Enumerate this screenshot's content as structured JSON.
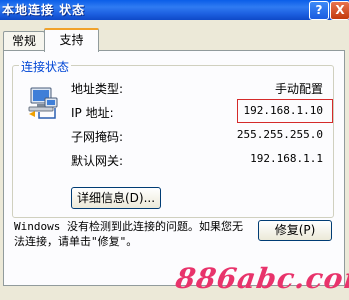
{
  "window": {
    "title": "本地连接 状态",
    "help_label": "?",
    "close_label": "X"
  },
  "tabs": [
    {
      "label": "常规",
      "active": false
    },
    {
      "label": "支持",
      "active": true
    }
  ],
  "group": {
    "title": "连接状态",
    "rows": [
      {
        "label": "地址类型:",
        "value": "手动配置"
      },
      {
        "label": "IP 地址:",
        "value": "192.168.1.10"
      },
      {
        "label": "子网掩码:",
        "value": "255.255.255.0"
      },
      {
        "label": "默认网关:",
        "value": "192.168.1.1"
      }
    ],
    "details_button": "详细信息(D)..."
  },
  "message": "Windows 没有检测到此连接的问题。如果您无法连接，请单击\"修复\"。",
  "repair_button": "修复(P)",
  "watermark": "886abc.com",
  "colors": {
    "titlebar": "#1c5fe0",
    "highlight": "#d42a2a",
    "watermark": "#e8336b"
  }
}
